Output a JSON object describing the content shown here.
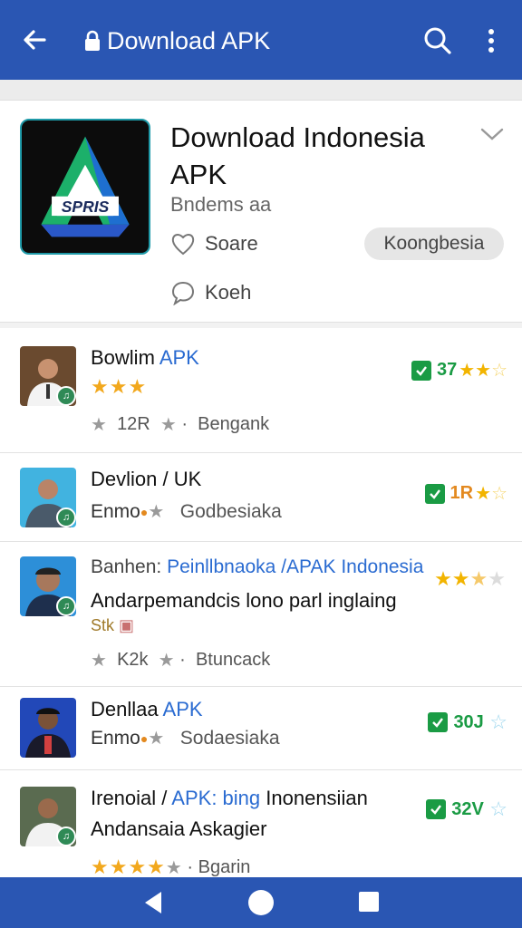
{
  "topbar": {
    "title": "Download APK"
  },
  "app": {
    "name": "Download Indonesia APK",
    "developer": "Bndems aa",
    "meta1": "Soare",
    "meta2": "Koeh",
    "pill": "Koongbesia",
    "icon_text": "SPRIS"
  },
  "items": [
    {
      "title": "Bowlim",
      "title_blue": "APK",
      "stars": "★★★",
      "meta_a": "12R",
      "meta_b": "Bengank",
      "tag": "37",
      "tag_color": "green"
    },
    {
      "title": "Devlion / UK",
      "sub": "Enmo",
      "meta_b": "Godbesiaka",
      "tag": "1R",
      "tag_color": "orange"
    },
    {
      "title": "Banhen:",
      "title_blue": "Peinllbnaoka /APAK Indonesia",
      "sub": "Andarpemandcis lono parl inglaing",
      "extra": "Stk",
      "meta_a": "K2k",
      "meta_b": "Btuncack"
    },
    {
      "title": "Denllaa",
      "title_blue": "APK",
      "sub": "Enmo",
      "meta_b": "Sodaesiaka",
      "tag": "30J",
      "tag_color": "green"
    },
    {
      "title": "Irenoial /",
      "title_blue": "APK: bing",
      "title_rest": "Inonensiian",
      "sub": "Andansaia Askagier",
      "meta_b": "Bgarin",
      "tag": "32V",
      "tag_color": "green"
    }
  ],
  "colors": {
    "topbar": "#2a56b3",
    "accent_blue": "#2a6bd1",
    "green": "#1a9b44",
    "star_orange": "#f2a81d"
  }
}
